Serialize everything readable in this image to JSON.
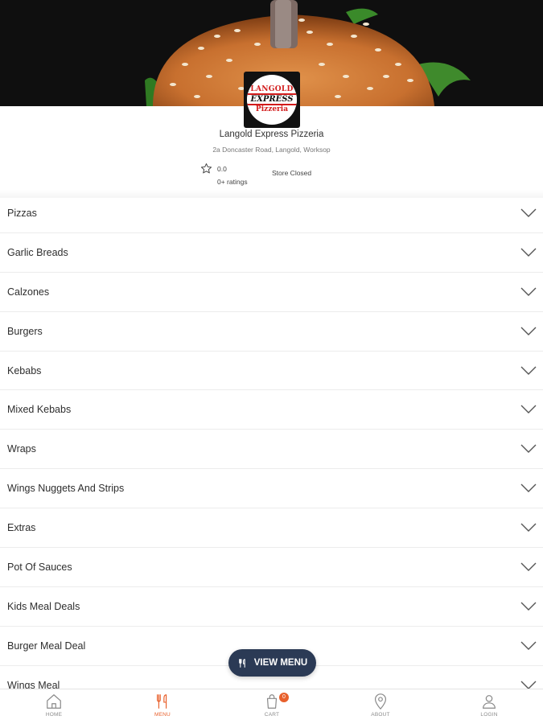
{
  "store": {
    "name": "Langold Express Pizzeria",
    "address": "2a Doncaster Road, Langold, Worksop",
    "rating": "0.0",
    "rating_count": "0+ ratings",
    "status": "Store Closed",
    "logo": {
      "top": "LANGOLD",
      "middle": "EXPRESS",
      "bottom": "Pizzeria"
    }
  },
  "menu": {
    "categories": [
      "Pizzas",
      "Garlic Breads",
      "Calzones",
      "Burgers",
      "Kebabs",
      "Mixed Kebabs",
      "Wraps",
      "Wings Nuggets And Strips",
      "Extras",
      "Pot Of Sauces",
      "Kids Meal Deals",
      "Burger Meal Deal",
      "Wings Meal"
    ]
  },
  "view_menu_button": {
    "label": "VIEW MENU",
    "icon": "cutlery-icon"
  },
  "bottom_nav": {
    "items": [
      {
        "label": "HOME",
        "icon": "home-icon"
      },
      {
        "label": "MENU",
        "icon": "cutlery-icon",
        "active": true
      },
      {
        "label": "CART",
        "icon": "cart-icon",
        "badge": "0"
      },
      {
        "label": "ABOUT",
        "icon": "location-pin-icon"
      },
      {
        "label": "LOGIN",
        "icon": "user-icon"
      }
    ]
  },
  "colors": {
    "accent": "#e8602c",
    "button_bg": "#2b3a55",
    "logo_red": "#d21b1b"
  }
}
